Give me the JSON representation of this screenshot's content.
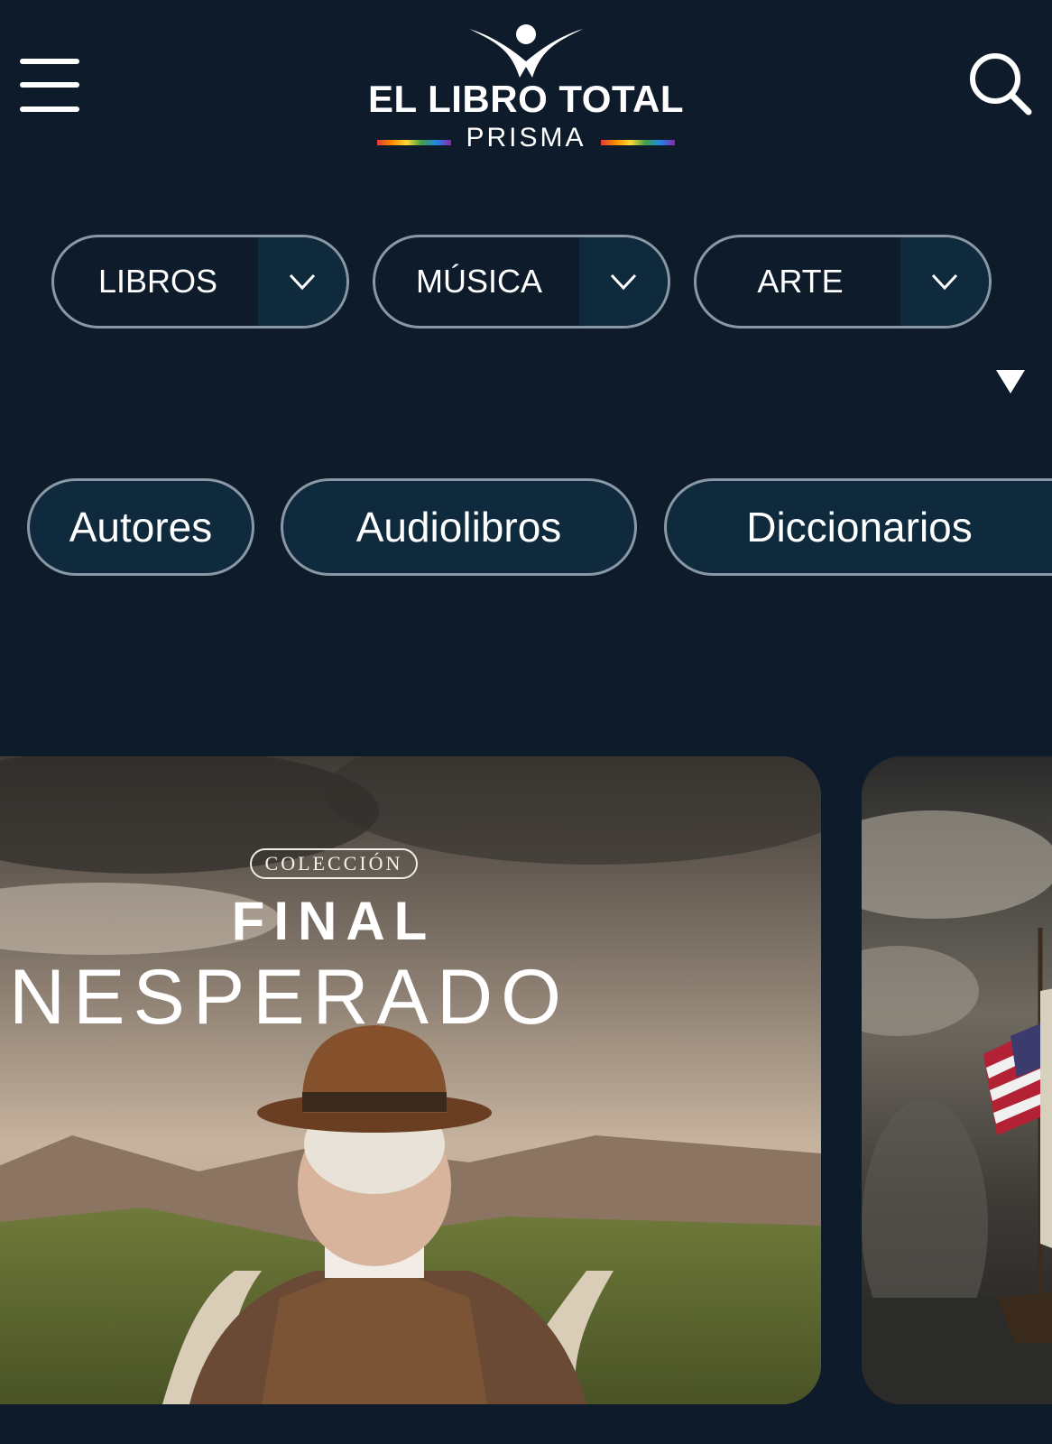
{
  "header": {
    "logo_title": "EL LIBRO TOTAL",
    "logo_subtitle": "PRISMA",
    "icons": {
      "menu": "hamburger-menu-icon",
      "search": "search-icon",
      "logo": "reader-figure-logo"
    }
  },
  "categories": [
    {
      "label": "LIBROS"
    },
    {
      "label": "MÚSICA"
    },
    {
      "label": "ARTE"
    }
  ],
  "quick_links": [
    {
      "label": "Autores"
    },
    {
      "label": "Audiolibros"
    },
    {
      "label": "Diccionarios"
    }
  ],
  "featured": [
    {
      "badge": "COLECCIÓN",
      "title_line1": "FINAL",
      "title_line2": "NESPERADO"
    }
  ],
  "colors": {
    "background": "#0d1b2a",
    "pill_fill": "#0f2a3d",
    "pill_border": "#8a98a6"
  }
}
